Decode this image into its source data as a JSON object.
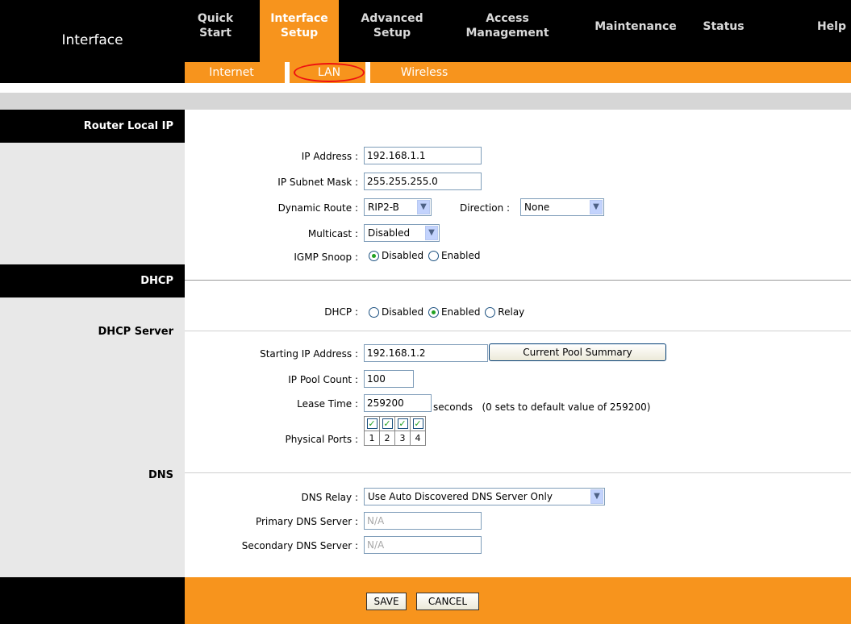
{
  "header": {
    "page_title": "Interface",
    "nav": [
      {
        "label": "Quick\nStart"
      },
      {
        "label": "Interface\nSetup"
      },
      {
        "label": "Advanced\nSetup"
      },
      {
        "label": "Access\nManagement"
      },
      {
        "label": "Maintenance"
      },
      {
        "label": "Status"
      },
      {
        "label": "Help"
      }
    ],
    "subnav": [
      {
        "label": "Internet"
      },
      {
        "label": "LAN"
      },
      {
        "label": "Wireless"
      }
    ]
  },
  "sections": {
    "router_local_ip": "Router Local IP",
    "dhcp": "DHCP",
    "dhcp_server": "DHCP Server",
    "dns": "DNS"
  },
  "router": {
    "ip_label": "IP Address :",
    "ip_value": "192.168.1.1",
    "mask_label": "IP Subnet Mask :",
    "mask_value": "255.255.255.0",
    "route_label": "Dynamic Route :",
    "route_value": "RIP2-B",
    "direction_label": "Direction :",
    "direction_value": "None",
    "multicast_label": "Multicast :",
    "multicast_value": "Disabled",
    "igmp_label": "IGMP Snoop :",
    "igmp_opt_disabled": "Disabled",
    "igmp_opt_enabled": "Enabled",
    "igmp_selected": "Disabled"
  },
  "dhcp": {
    "dhcp_label": "DHCP :",
    "opt_disabled": "Disabled",
    "opt_enabled": "Enabled",
    "opt_relay": "Relay",
    "selected": "Enabled",
    "start_label": "Starting IP Address :",
    "start_value": "192.168.1.2",
    "pool_summary_button": "Current Pool Summary",
    "pool_count_label": "IP Pool Count :",
    "pool_count_value": "100",
    "lease_label": "Lease Time :",
    "lease_value": "259200",
    "lease_suffix": "seconds   (0 sets to default value of 259200)",
    "ports_label": "Physical Ports :",
    "ports": [
      {
        "num": "1",
        "checked": true
      },
      {
        "num": "2",
        "checked": true
      },
      {
        "num": "3",
        "checked": true
      },
      {
        "num": "4",
        "checked": true
      }
    ]
  },
  "dns": {
    "relay_label": "DNS Relay :",
    "relay_value": "Use Auto Discovered DNS Server Only",
    "primary_label": "Primary DNS Server :",
    "primary_value": "N/A",
    "secondary_label": "Secondary DNS Server :",
    "secondary_value": "N/A"
  },
  "footer": {
    "save": "SAVE",
    "cancel": "CANCEL"
  },
  "colors": {
    "accent": "#f7941d",
    "header_bg": "#000000",
    "sidebar_bg": "#e8e8e8",
    "annotation_circle": "#e11111"
  },
  "icons": {
    "dropdown": "chevron-down-icon",
    "check": "checkmark-icon",
    "radio": "radio-icon"
  }
}
